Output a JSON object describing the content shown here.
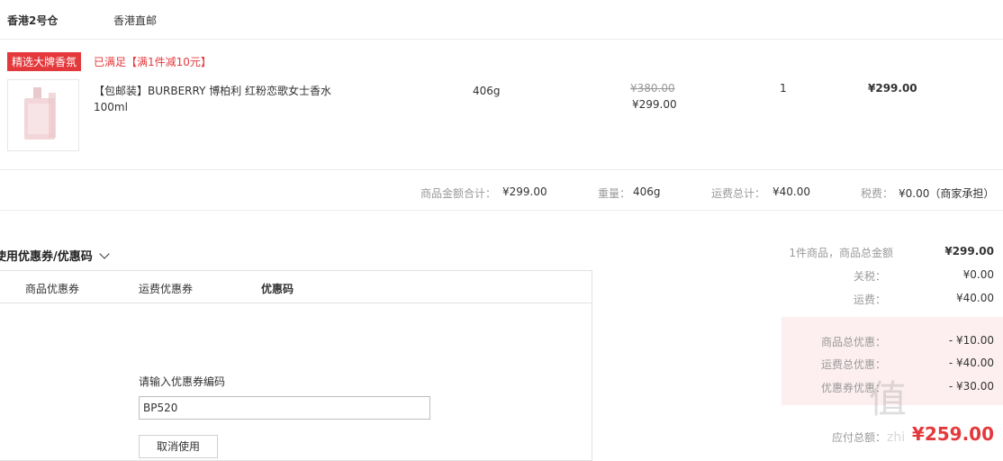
{
  "warehouse": {
    "name": "香港2号仓",
    "shipping": "香港直邮"
  },
  "promo": {
    "tag": "精选大牌香氛",
    "note": "已满足【满1件减10元】"
  },
  "product": {
    "title_line1": "【包邮装】BURBERRY 博柏利 红粉恋歌女士香水",
    "title_line2": "100ml",
    "weight": "406g",
    "original_price": "¥380.00",
    "price": "¥299.00",
    "qty": "1",
    "subtotal": "¥299.00"
  },
  "summary_row": {
    "goods_total_label": "商品金额合计：",
    "goods_total_value": "¥299.00",
    "weight_label": "重量：",
    "weight_value": "406g",
    "shipping_label": "运费总计：",
    "shipping_value": "¥40.00",
    "tax_label": "税费：",
    "tax_value": "¥0.00（商家承担）"
  },
  "coupon": {
    "header": "使用优惠券/优惠码",
    "tabs": [
      "商品优惠券",
      "运费优惠券",
      "优惠码"
    ],
    "input_label": "请输入优惠券编码",
    "input_value": "BP520",
    "cancel_label": "取消使用"
  },
  "totals": {
    "count_label": "1件商品，商品总金额",
    "count_value": "¥299.00",
    "duty_label": "关税：",
    "duty_value": "¥0.00",
    "ship_label": "运费：",
    "ship_value": "¥40.00",
    "goods_discount_label": "商品总优惠：",
    "goods_discount_value": "- ¥10.00",
    "ship_discount_label": "运费总优惠：",
    "ship_discount_value": "- ¥40.00",
    "coupon_discount_label": "优惠券优惠：",
    "coupon_discount_value": "- ¥30.00",
    "payable_label": "应付总额：",
    "payable_value": "¥259.00"
  },
  "watermark": {
    "big": "值",
    "small": "zhi"
  }
}
